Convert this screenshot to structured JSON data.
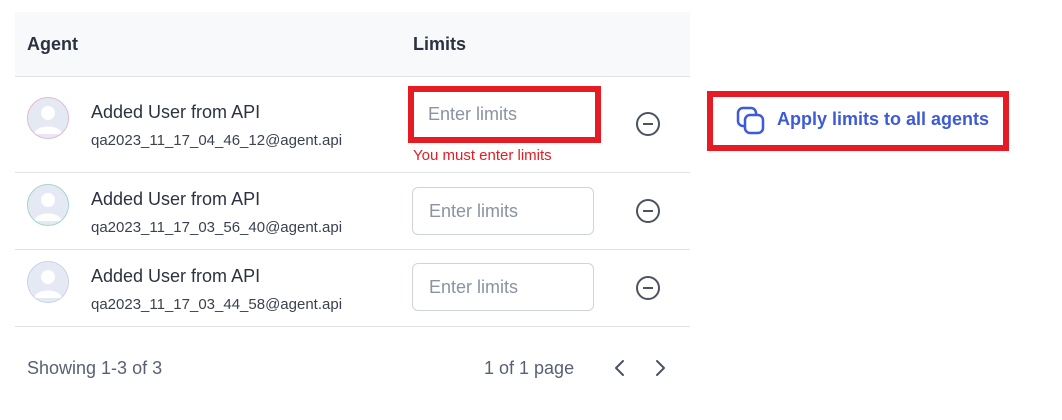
{
  "table": {
    "headers": {
      "agent": "Agent",
      "limits": "Limits"
    },
    "rows": [
      {
        "name": "Added User from API",
        "email": "qa2023_11_17_04_46_12@agent.api",
        "limit_value": "",
        "limit_placeholder": "Enter limits",
        "error": "You must enter limits"
      },
      {
        "name": "Added User from API",
        "email": "qa2023_11_17_03_56_40@agent.api",
        "limit_value": "",
        "limit_placeholder": "Enter limits"
      },
      {
        "name": "Added User from API",
        "email": "qa2023_11_17_03_44_58@agent.api",
        "limit_value": "",
        "limit_placeholder": "Enter limits"
      }
    ]
  },
  "footer": {
    "showing": "Showing 1-3 of 3",
    "page_info": "1 of 1 page"
  },
  "apply": {
    "label": "Apply limits to all agents",
    "icon": "copy-icon"
  },
  "colors": {
    "error": "#e61b23",
    "accent": "#3d5ad8",
    "header_bg": "#f8f9fb"
  }
}
